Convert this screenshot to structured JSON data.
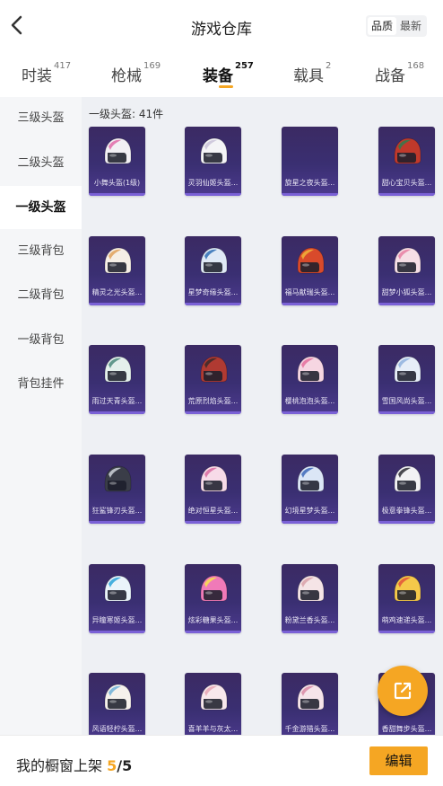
{
  "header": {
    "title": "游戏仓库",
    "sort_options": [
      "品质",
      "最新"
    ],
    "sort_active": "品质"
  },
  "tabs": [
    {
      "label": "时装",
      "count": "417"
    },
    {
      "label": "枪械",
      "count": "169"
    },
    {
      "label": "装备",
      "count": "257",
      "active": true
    },
    {
      "label": "载具",
      "count": "2"
    },
    {
      "label": "战备",
      "count": "168"
    }
  ],
  "sidebar": {
    "items": [
      {
        "label": "三级头盔"
      },
      {
        "label": "二级头盔"
      },
      {
        "label": "一级头盔",
        "active": true
      },
      {
        "label": "三级背包"
      },
      {
        "label": "二级背包"
      },
      {
        "label": "一级背包"
      },
      {
        "label": "背包挂件"
      }
    ]
  },
  "content": {
    "section_title": "一级头盔: 41件",
    "items": [
      {
        "name": "小舞头盔(1级)",
        "color": "#f2f0f4",
        "accent": "#e26aa8",
        "icon": "helmet-icon"
      },
      {
        "name": "灵羽仙姬头盔...",
        "color": "#f4f4f6",
        "accent": "#c9c2d8",
        "icon": "helmet-icon"
      },
      {
        "name": "旋星之夜头盔...",
        "color": "",
        "accent": "",
        "icon": ""
      },
      {
        "name": "甜心宝贝头盔...",
        "color": "#c0392b",
        "accent": "#2e7d4f",
        "icon": "helmet-icon"
      },
      {
        "name": "精灵之光头盔...",
        "color": "#f6efe6",
        "accent": "#e0a15a",
        "icon": "helmet-icon"
      },
      {
        "name": "星梦奇缘头盔...",
        "color": "#dfe9f6",
        "accent": "#2f6fb5",
        "icon": "helmet-icon"
      },
      {
        "name": "福马献瑞头盔...",
        "color": "#d94a2b",
        "accent": "#f0b43a",
        "icon": "helmet-icon"
      },
      {
        "name": "甜梦小狐头盔...",
        "color": "#f6dfe6",
        "accent": "#e77fa2",
        "icon": "helmet-icon"
      },
      {
        "name": "雨过天青头盔...",
        "color": "#e4f0ec",
        "accent": "#4b8a7c",
        "icon": "helmet-icon"
      },
      {
        "name": "荒原烈焰头盔...",
        "color": "#b03a32",
        "accent": "#3a2a2a",
        "icon": "helmet-icon"
      },
      {
        "name": "樱桃泡泡头盔...",
        "color": "#f6d6e2",
        "accent": "#e56f9c",
        "icon": "helmet-icon"
      },
      {
        "name": "雪国风尚头盔...",
        "color": "#e6eef8",
        "accent": "#8fb1de",
        "icon": "helmet-icon"
      },
      {
        "name": "狂鲨锋刃头盔...",
        "color": "#3a3d48",
        "accent": "#cfd3da",
        "icon": "helmet-icon"
      },
      {
        "name": "绝对恒星头盔...",
        "color": "#f7dbe8",
        "accent": "#d96aa0",
        "icon": "helmet-icon"
      },
      {
        "name": "幻境星梦头盔...",
        "color": "#dbe6f6",
        "accent": "#3d67b8",
        "icon": "helmet-icon"
      },
      {
        "name": "极意拳锋头盔...",
        "color": "#f2f2f4",
        "accent": "#2d2d33",
        "icon": "helmet-icon"
      },
      {
        "name": "异瞳寒姬头盔...",
        "color": "#eaf4fa",
        "accent": "#2aa3d8",
        "icon": "helmet-icon"
      },
      {
        "name": "炫彩糖果头盔...",
        "color": "#f07ab8",
        "accent": "#f7e34b",
        "icon": "helmet-icon"
      },
      {
        "name": "粉黛兰香头盔...",
        "color": "#f5e4e6",
        "accent": "#d9a1a8",
        "icon": "helmet-icon"
      },
      {
        "name": "萌鸡速递头盔...",
        "color": "#f5c94a",
        "accent": "#e2543a",
        "icon": "helmet-icon"
      },
      {
        "name": "风语轻柠头盔...",
        "color": "#f6f1ec",
        "accent": "#6fb0d8",
        "icon": "helmet-icon"
      },
      {
        "name": "喜羊羊与灰太...",
        "color": "#f8e8ec",
        "accent": "#e6a4b4",
        "icon": "helmet-icon"
      },
      {
        "name": "千金游猎头盔...",
        "color": "#f6e4ea",
        "accent": "#d98aa4",
        "icon": "helmet-icon"
      },
      {
        "name": "香甜舞步头盔...",
        "color": "#f4efe8",
        "accent": "#e5b06a",
        "icon": "helmet-icon"
      }
    ]
  },
  "fab": {
    "icon": "share-icon"
  },
  "bottom": {
    "label": "我的橱窗上架",
    "count": "5",
    "total": "/5",
    "edit_label": "编辑"
  },
  "theme": {
    "accent": "#f5a623",
    "card_bg": "#3a2f72"
  }
}
